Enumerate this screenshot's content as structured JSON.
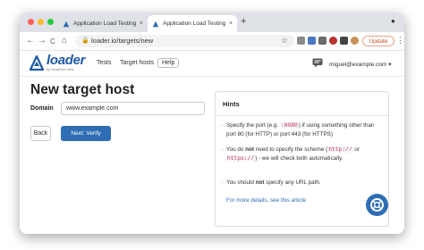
{
  "browser": {
    "tabs": [
      {
        "title": "Application Load Testing Tools",
        "close": "×"
      },
      {
        "title": "Application Load Testing Tools",
        "close": "×"
      }
    ],
    "new_tab": "+",
    "url": "loader.io/targets/new",
    "update_label": "Update",
    "nav": {
      "back": "←",
      "forward": "→",
      "reload": "C",
      "home": "⌂",
      "star": "☆",
      "menu": "⋮",
      "circle": "●"
    }
  },
  "app": {
    "logo": "loader",
    "logo_sub": "by SendGrid Labs",
    "nav": {
      "tests": "Tests",
      "target_hosts": "Target hosts",
      "help": "Help"
    },
    "user": "miguel@example.com",
    "caret": "▾"
  },
  "page": {
    "title": "New target host",
    "domain_label": "Domain",
    "domain_value": "www.example.com",
    "back_label": "Back",
    "verify_label": "Next: Verify"
  },
  "hints": {
    "title": "Hints",
    "bullet": "-",
    "hint1": {
      "a": "Specify the port (e.g. ",
      "code": ":8080",
      "b": ") if using something other than port 80 (for HTTP) or port 443 (for HTTPS)"
    },
    "hint2": {
      "a": "You do ",
      "strong": "not",
      "b": " need to specify the scheme (",
      "code1": "http://",
      "c": " or ",
      "code2": "https://",
      "d": ") - we will check both automatically."
    },
    "hint3": {
      "a": "You should ",
      "strong": "not",
      "b": " specify any URL path."
    },
    "link": "For more details, see this article"
  },
  "colors": {
    "accent": "#2f6db5",
    "tabbar": "#dee1e6",
    "update": "#c94f27"
  }
}
